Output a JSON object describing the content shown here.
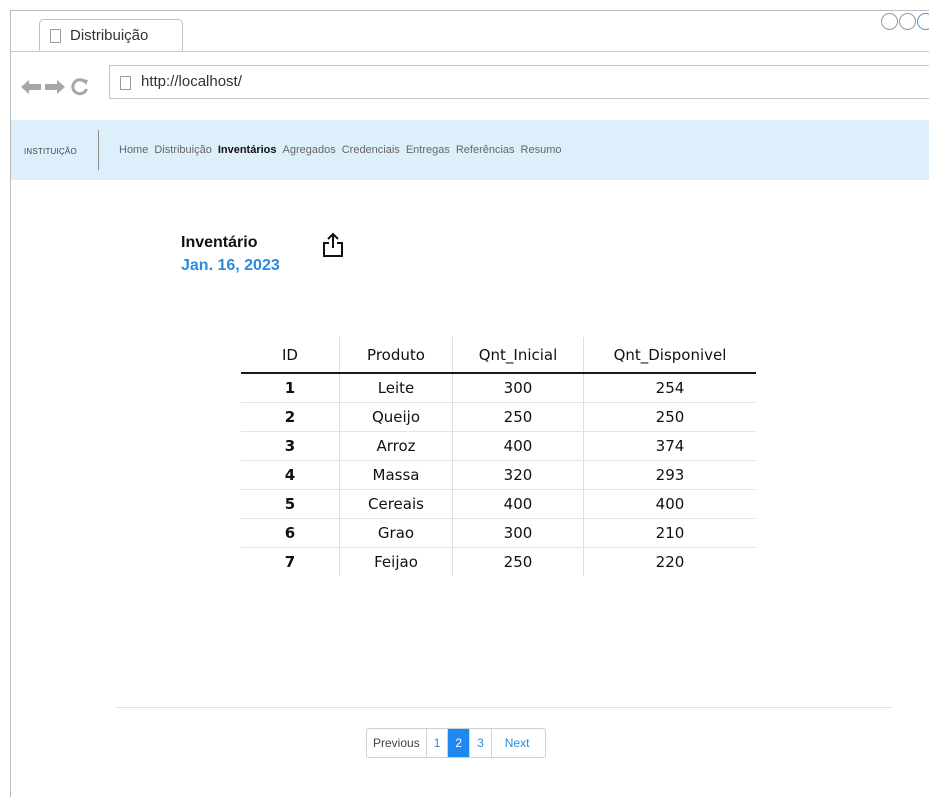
{
  "browser": {
    "tab_title": "Distribuição",
    "url": "http://localhost/"
  },
  "appnav": {
    "brand": "INSTITUIÇÃO",
    "items": [
      {
        "label": "Home"
      },
      {
        "label": "Distribuição"
      },
      {
        "label": "Inventários",
        "active": true
      },
      {
        "label": "Agregados"
      },
      {
        "label": "Credenciais"
      },
      {
        "label": "Entregas"
      },
      {
        "label": "Referências"
      },
      {
        "label": "Resumo"
      }
    ]
  },
  "content": {
    "title": "Inventário",
    "date": "Jan. 16, 2023",
    "date_color": "#2a8be0"
  },
  "table": {
    "headers": [
      "ID",
      "Produto",
      "Qnt_Inicial",
      "Qnt_Disponivel"
    ],
    "rows": [
      [
        "1",
        "Leite",
        "300",
        "254"
      ],
      [
        "2",
        "Queijo",
        "250",
        "250"
      ],
      [
        "3",
        "Arroz",
        "400",
        "374"
      ],
      [
        "4",
        "Massa",
        "320",
        "293"
      ],
      [
        "5",
        "Cereais",
        "400",
        "400"
      ],
      [
        "6",
        "Grao",
        "300",
        "210"
      ],
      [
        "7",
        "Feijao",
        "250",
        "220"
      ]
    ]
  },
  "pagination": {
    "previous": "Previous",
    "pages": [
      "1",
      "2",
      "3"
    ],
    "active_page": "2",
    "next": "Next"
  },
  "icons": {
    "share": "share-icon",
    "back": "back-arrow-icon",
    "forward": "forward-arrow-icon",
    "reload": "reload-icon"
  }
}
